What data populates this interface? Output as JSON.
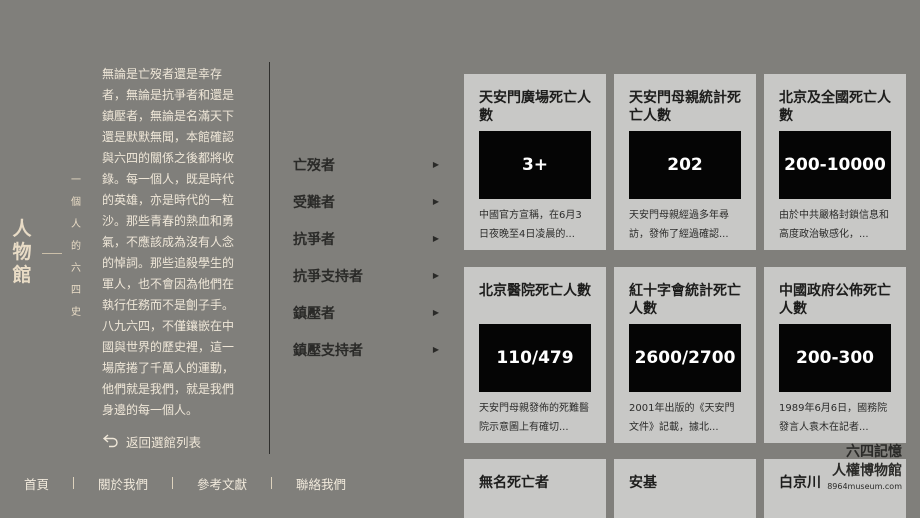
{
  "sidebar": {
    "title": "人物館",
    "subtitle": "一個人的六四史",
    "intro": "無論是亡歿者還是幸存者，無論是抗爭者和還是鎮壓者，無論是名滿天下還是默默無聞，本館確認與六四的關係之後都將收錄。每一個人，既是時代的英雄，亦是時代的一粒沙。那些青春的熱血和勇氣，不應該成為沒有人念的悼詞。那些追殺學生的軍人，也不會因為他們在執行任務而不是劊子手。八九六四，不僅鑲嵌在中國與世界的歷史裡，這一場席捲了千萬人的運動，他們就是我們，就是我們身邊的每一個人。",
    "back_label": "返回選館列表",
    "back_icon": "return-arrow-icon"
  },
  "categories": [
    {
      "label": "亡歿者"
    },
    {
      "label": "受難者"
    },
    {
      "label": "抗爭者"
    },
    {
      "label": "抗爭支持者"
    },
    {
      "label": "鎮壓者"
    },
    {
      "label": "鎮壓支持者"
    }
  ],
  "footer_nav": [
    {
      "label": "首頁"
    },
    {
      "label": "關於我們"
    },
    {
      "label": "參考文獻"
    },
    {
      "label": "聯絡我們"
    }
  ],
  "cards": [
    {
      "title": "天安門廣場死亡人數",
      "value": "3+",
      "desc": "中國官方宣稱，在6月3日夜晚至4日凌晨的..."
    },
    {
      "title": "天安門母親統計死亡人數",
      "value": "202",
      "desc": "天安門母親經過多年尋訪，發佈了經過確認..."
    },
    {
      "title": "北京及全國死亡人數",
      "value": "200-10000",
      "desc": "由於中共嚴格封鎖信息和高度政治敏感化，..."
    },
    {
      "title": "北京醫院死亡人數",
      "value": "110/479",
      "desc": "天安門母親發佈的死難醫院示意圖上有確切..."
    },
    {
      "title": "紅十字會統計死亡人數",
      "value": "2600/2700",
      "desc": "2001年出版的《天安門文件》記載，據北..."
    },
    {
      "title": "中國政府公佈死亡人數",
      "value": "200-300",
      "desc": "1989年6月6日，國務院發言人袁木在記者..."
    },
    {
      "title": "無名死亡者",
      "value": "",
      "desc": ""
    },
    {
      "title": "安基",
      "value": "",
      "desc": ""
    },
    {
      "title": "白京川",
      "value": "",
      "desc": ""
    }
  ],
  "logo": {
    "line1": "六四記憶",
    "line2": "人權博物館",
    "line3": "8964museum.com"
  },
  "colors": {
    "background": "#807f7b",
    "card": "#c8c8c6",
    "value_box": "#050505",
    "sidebar_text": "#efe7d8"
  }
}
